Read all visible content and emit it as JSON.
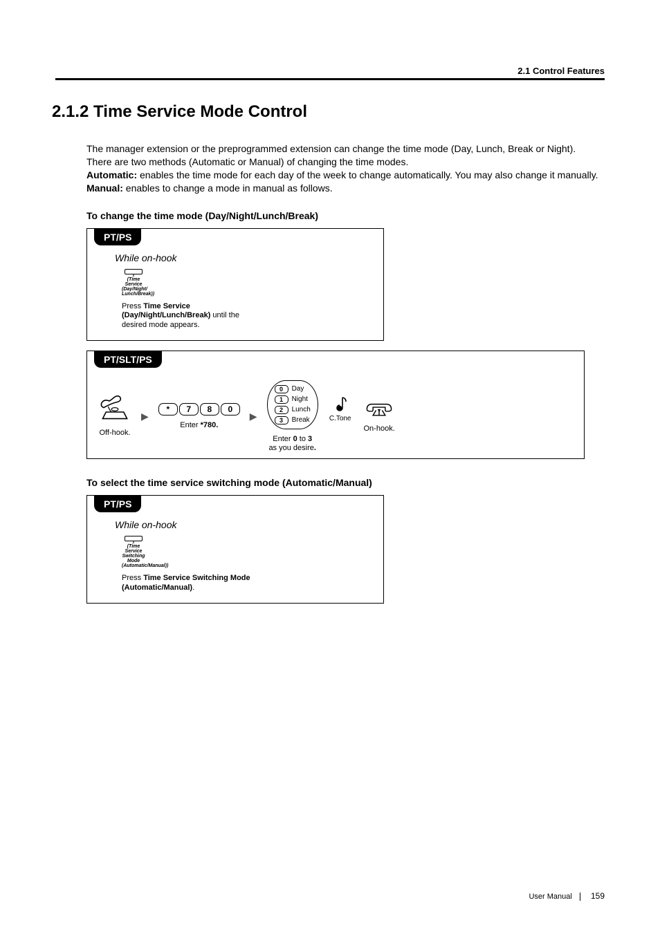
{
  "header": {
    "breadcrumb": "2.1 Control Features"
  },
  "section": {
    "number_title": "2.1.2   Time Service Mode Control"
  },
  "intro": {
    "p1": "The manager extension or the preprogrammed extension can change the time mode (Day, Lunch, Break or Night).",
    "p2": "There are two methods (Automatic or Manual) of changing the time modes.",
    "auto_label": "Automatic:",
    "auto_text": " enables the time mode for each day of the week to change automatically. You may also change it manually.",
    "manual_label": "Manual:",
    "manual_text": " enables to change a mode in manual as follows."
  },
  "subheads": {
    "change_mode": "To change the time mode (Day/Night/Lunch/Break)",
    "select_switch": "To select the time service switching mode (Automatic/Manual)"
  },
  "box1": {
    "tab": "PT/PS",
    "while": "While on-hook",
    "button_label": "(Time Service\n(Day/Night/\nLunch/Break))",
    "press_pre": "Press ",
    "press_bold": "Time Service (Day/Night/Lunch/Break)",
    "press_post": " until the desired mode appears."
  },
  "box2": {
    "tab": "PT/SLT/PS",
    "offhook": "Off-hook.",
    "enter_code_pre": "Enter ",
    "enter_code_bold": "780.",
    "keys": [
      "*",
      "7",
      "8",
      "0"
    ],
    "options": [
      {
        "k": "0",
        "t": "Day"
      },
      {
        "k": "1",
        "t": "Night"
      },
      {
        "k": "2",
        "t": "Lunch"
      },
      {
        "k": "3",
        "t": "Break"
      }
    ],
    "enter_range_l1_pre": "Enter ",
    "enter_range_l1_b1": "0",
    "enter_range_l1_mid": " to ",
    "enter_range_l1_b2": "3",
    "enter_range_l2": "as you desire",
    "ctone": "C.Tone",
    "onhook": "On-hook."
  },
  "box3": {
    "tab": "PT/PS",
    "while": "While on-hook",
    "button_label": "(Time Service\nSwitching Mode\n(Automatic/Manual))",
    "press_pre": "Press ",
    "press_bold": "Time Service Switching Mode (Automatic/Manual)",
    "press_post": "."
  },
  "footer": {
    "label": "User Manual",
    "page": "159"
  }
}
